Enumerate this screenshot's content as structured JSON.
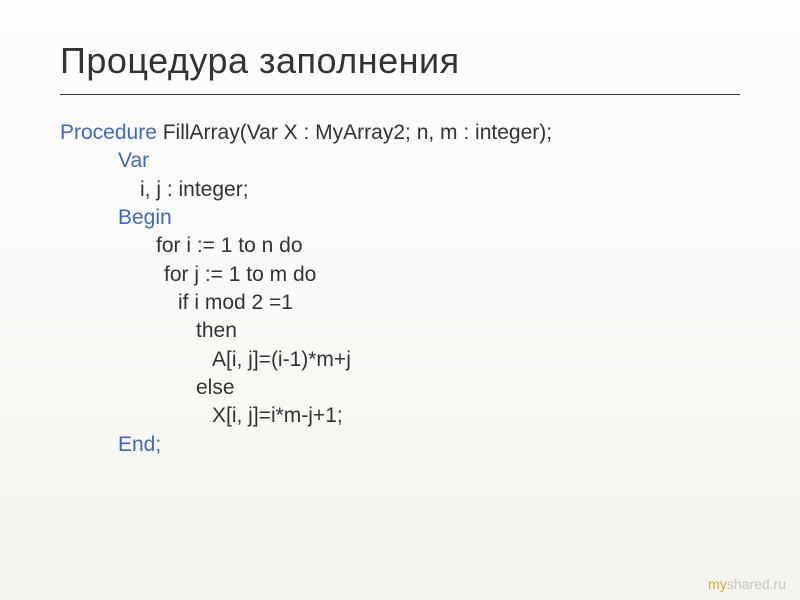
{
  "title": "Процедура заполнения",
  "code": {
    "l1_kw": "Procedure",
    "l1_rest": " FillArray(Var X : MyArray2; n, m : integer);",
    "l2": "Var",
    "l3": "i, j : integer;",
    "l4": "Begin",
    "l5": "for i := 1 to n do",
    "l6": "for j := 1 to m do",
    "l7": "if i mod 2 =1",
    "l8": "then",
    "l9": "A[i, j]=(i-1)*m+j",
    "l10": "else",
    "l11": "X[i, j]=i*m-j+1;",
    "l12": "End;"
  },
  "watermark": {
    "prefix": "my",
    "suffix": "shared.ru"
  }
}
